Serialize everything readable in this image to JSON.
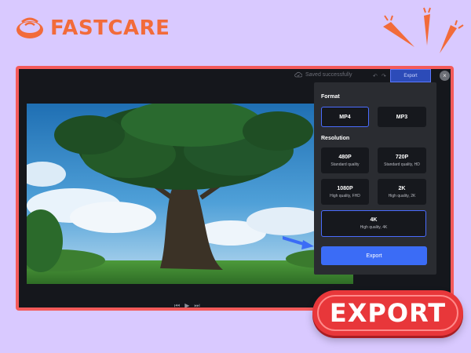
{
  "brand": {
    "name": "FASTCARE",
    "color": "#f26b3a"
  },
  "toolbar": {
    "saved_status": "Saved successfully",
    "undo_icon": "undo-icon",
    "redo_icon": "redo-icon",
    "export_label": "Export",
    "close_icon": "close-icon"
  },
  "export_panel": {
    "format_label": "Format",
    "formats": [
      {
        "label": "MP4",
        "selected": true
      },
      {
        "label": "MP3",
        "selected": false
      }
    ],
    "resolution_label": "Resolution",
    "resolutions": [
      {
        "label": "480P",
        "desc": "Standard quality",
        "selected": false
      },
      {
        "label": "720P",
        "desc": "Standard quality, HD",
        "selected": false
      },
      {
        "label": "1080P",
        "desc": "High quality, FHD",
        "selected": false
      },
      {
        "label": "2K",
        "desc": "High quality, 2K",
        "selected": false
      },
      {
        "label": "4K",
        "desc": "High quality, 4K",
        "selected": true
      }
    ],
    "export_button": "Export"
  },
  "playback": {
    "prev_icon": "skip-back-icon",
    "play_icon": "play-icon",
    "next_icon": "skip-forward-icon"
  },
  "badge": {
    "label": "EXPORT",
    "color": "#e8373a"
  },
  "colors": {
    "background": "#d9c9ff",
    "frame": "#f45a5a",
    "accent": "#3b6cf6"
  }
}
